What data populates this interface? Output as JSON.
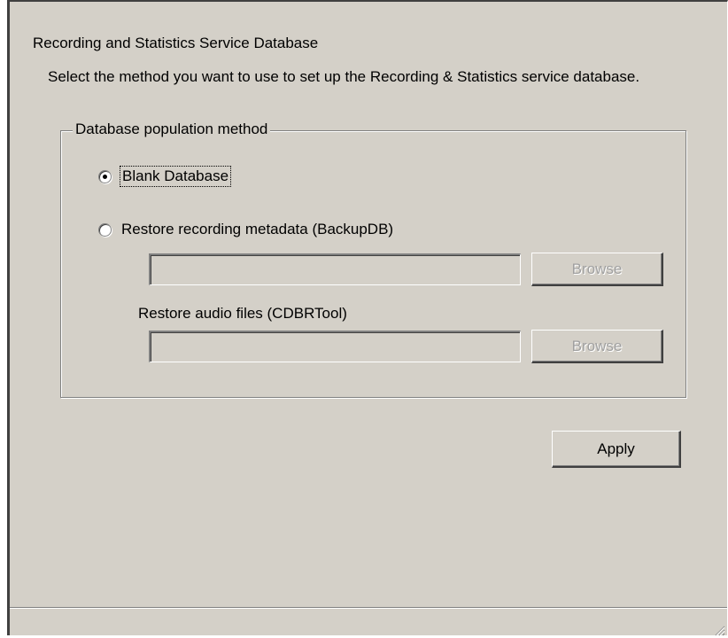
{
  "section": {
    "heading": "Recording and Statistics Service Database",
    "description": "Select the method you want to use to set up the Recording & Statistics service database."
  },
  "group": {
    "legend": "Database population method",
    "options": [
      {
        "label": "Blank Database",
        "selected": true
      },
      {
        "label": "Restore recording metadata (BackupDB)",
        "selected": false
      }
    ],
    "metadata_path": {
      "value": "",
      "browse_label": "Browse",
      "enabled": false
    },
    "audio_label": "Restore audio files (CDBRTool)",
    "audio_path": {
      "value": "",
      "browse_label": "Browse",
      "enabled": false
    }
  },
  "actions": {
    "apply_label": "Apply"
  },
  "icons": {
    "radio_selected": "radio-dot-icon",
    "resize_grip": "resize-grip-icon"
  }
}
